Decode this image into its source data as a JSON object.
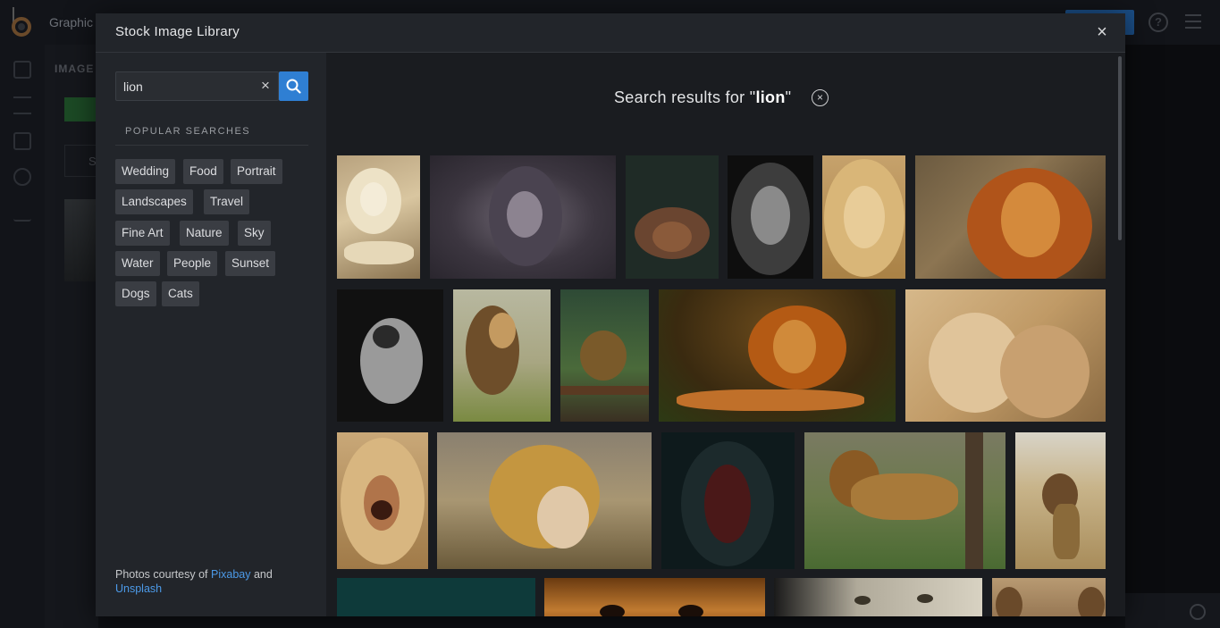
{
  "app": {
    "title": "Graphic",
    "panel_label": "IMAGE",
    "panel_letter": "S",
    "help_icon": "help-circle-icon",
    "menu_icon": "hamburger-menu-icon"
  },
  "modal": {
    "title": "Stock Image Library",
    "close_label": "×",
    "close_icon": "close-icon"
  },
  "search": {
    "value": "lion",
    "placeholder": "",
    "clear_label": "×",
    "clear_icon": "clear-icon",
    "button_icon": "search-icon",
    "button_color": "#2f7fd3"
  },
  "popular": {
    "title": "POPULAR SEARCHES",
    "tags": [
      "Wedding",
      "Food",
      "Portrait",
      "Landscapes",
      "Travel",
      "Fine Art",
      "Nature",
      "Sky",
      "Water",
      "People",
      "Sunset",
      "Dogs",
      "Cats"
    ]
  },
  "credits": {
    "prefix": "Photos courtesy of ",
    "pixabay": "Pixabay",
    "middle": " and",
    "unsplash": "Unsplash",
    "link_color": "#4c9ae8"
  },
  "results": {
    "heading_prefix": "Search results for \"",
    "query": "lion",
    "heading_suffix": "\"",
    "clear_label": "×",
    "clear_icon": "clear-search-circle-icon"
  },
  "photos": [
    {
      "alt": "white lion lying"
    },
    {
      "alt": "lion in mist"
    },
    {
      "alt": "lion on dark green"
    },
    {
      "alt": "black and white lion portrait"
    },
    {
      "alt": "golden lion face"
    },
    {
      "alt": "lion with orange mane"
    },
    {
      "alt": "lioness roaring black and white"
    },
    {
      "alt": "lion walking in grass"
    },
    {
      "alt": "lion on log in forest"
    },
    {
      "alt": "lion lying in sunset light"
    },
    {
      "alt": "two lionesses cuddling"
    },
    {
      "alt": "lion roaring close-up"
    },
    {
      "alt": "child hugging lion"
    },
    {
      "alt": "lion roaring in dark"
    },
    {
      "alt": "lion walking by tree"
    },
    {
      "alt": "lion on dry grass"
    },
    {
      "alt": "lion in teal light"
    },
    {
      "alt": "lion eyes close-up"
    },
    {
      "alt": "white lion face"
    },
    {
      "alt": "lion ears"
    }
  ]
}
